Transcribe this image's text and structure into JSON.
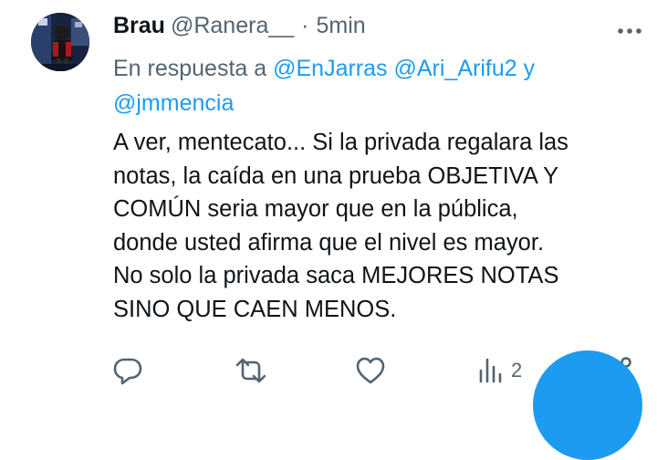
{
  "tweet": {
    "author_name": "Brau",
    "author_handle": "@Ranera__",
    "separator": "·",
    "time": "5min",
    "reply_prefix": "En respuesta a",
    "mention_1": "@EnJarras",
    "mention_2": "@Ari_Arifu2",
    "mention_join": "y",
    "mention_3": "@jmmencia",
    "body_lines": [
      "A ver, mentecato... Si la privada regalara las",
      "notas, la caída en una prueba OBJETIVA Y",
      "COMÚN seria mayor que en la pública,",
      "donde usted afirma que el nivel es mayor.",
      "No solo la privada saca MEJORES NOTAS",
      "SINO QUE CAEN MENOS."
    ]
  },
  "actions": {
    "reply_icon": "comment-icon",
    "retweet_icon": "retweet-icon",
    "like_icon": "heart-icon",
    "views_icon": "bar-chart-icon",
    "views_count": "2",
    "share_icon": "share-icon"
  },
  "colors": {
    "accent": "#1d9bf0",
    "secondary_text": "#536471",
    "primary_text": "#0f1419"
  }
}
